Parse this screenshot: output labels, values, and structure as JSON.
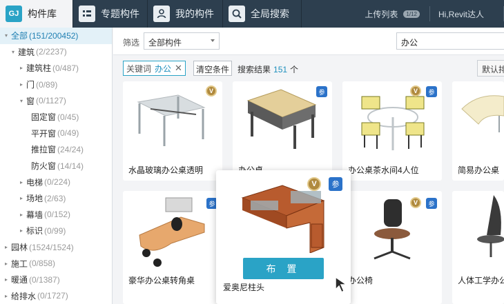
{
  "tabs": [
    {
      "icon": "gj-logo-icon",
      "label": "构件库",
      "logo_text": "GJ"
    },
    {
      "icon": "grid-list-icon",
      "label": "专题构件"
    },
    {
      "icon": "user-icon",
      "label": "我的构件"
    },
    {
      "icon": "search-icon",
      "label": "全局搜索"
    }
  ],
  "header": {
    "upload_label": "上传列表",
    "upload_count": "1/12",
    "user_label": "Hi,Revit达人"
  },
  "tree": [
    {
      "label": "全部",
      "count": "(151/200452)",
      "level": 0,
      "arrow": "▾",
      "selected": true
    },
    {
      "label": "建筑",
      "count": "(2/2237)",
      "level": 1,
      "arrow": "▾"
    },
    {
      "label": "建筑柱",
      "count": "(0/487)",
      "level": 2,
      "arrow": "▸"
    },
    {
      "label": "门",
      "count": "(0/89)",
      "level": 2,
      "arrow": "▸"
    },
    {
      "label": "窗",
      "count": "(0/1127)",
      "level": 2,
      "arrow": "▾"
    },
    {
      "label": "固定窗",
      "count": "(0/45)",
      "level": 3,
      "arrow": ""
    },
    {
      "label": "平开窗",
      "count": "(0/49)",
      "level": 3,
      "arrow": ""
    },
    {
      "label": "推拉窗",
      "count": "(24/24)",
      "level": 3,
      "arrow": ""
    },
    {
      "label": "防火窗",
      "count": "(14/14)",
      "level": 3,
      "arrow": ""
    },
    {
      "label": "电梯",
      "count": "(0/224)",
      "level": 2,
      "arrow": "▸"
    },
    {
      "label": "场地",
      "count": "(2/63)",
      "level": 2,
      "arrow": "▸"
    },
    {
      "label": "幕墙",
      "count": "(0/152)",
      "level": 2,
      "arrow": "▸"
    },
    {
      "label": "标识",
      "count": "(0/99)",
      "level": 2,
      "arrow": "▸"
    },
    {
      "label": "园林",
      "count": "(1524/1524)",
      "level": 0,
      "arrow": "▸"
    },
    {
      "label": "施工",
      "count": "(0/858)",
      "level": 0,
      "arrow": "▸"
    },
    {
      "label": "暖通",
      "count": "(0/1387)",
      "level": 0,
      "arrow": "▸"
    },
    {
      "label": "给排水",
      "count": "(0/1727)",
      "level": 0,
      "arrow": "▸"
    }
  ],
  "filter": {
    "label": "筛选",
    "selected": "全部构件",
    "search_value": "办公"
  },
  "results": {
    "keyword_label": "关键词",
    "keyword": "办公",
    "clear_label": "清空条件",
    "result_label": "搜索结果",
    "count": "151",
    "unit": "个",
    "sort_label": "默认排"
  },
  "cards": [
    {
      "name": "水晶玻璃办公桌透明",
      "v": true,
      "c": false
    },
    {
      "name": "办公桌",
      "v": false,
      "c": true
    },
    {
      "name": "办公桌茶水间4人位",
      "v": true,
      "c": true
    },
    {
      "name": "简易办公桌",
      "v": false,
      "c": false
    },
    {
      "name": "豪华办公桌转角桌",
      "v": false,
      "c": true
    },
    {
      "name": "办公椅",
      "v": true,
      "c": true
    },
    {
      "name": "人体工学办公",
      "v": false,
      "c": false
    }
  ],
  "popup": {
    "name": "爱奥尼柱头",
    "button": "布 置",
    "v": "V",
    "c": "参"
  },
  "badges": {
    "v": "V",
    "c": "参"
  }
}
